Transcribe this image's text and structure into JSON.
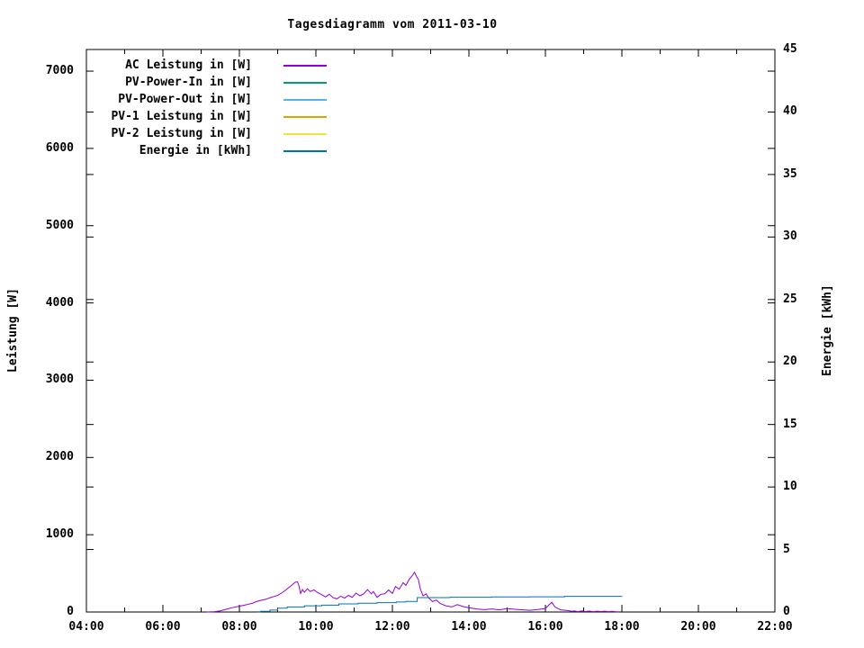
{
  "window": {
    "kind": "gnuplot-style daily PV diagram",
    "background": "#ffffff"
  },
  "chart_data": {
    "type": "line",
    "title": "Tagesdiagramm vom 2011-03-10",
    "grid": false,
    "legend_position": "top-left-inside-no-box",
    "x_axis": {
      "unit": "time-of-day",
      "range_hours": [
        4,
        22
      ],
      "major_tick_hours": [
        4,
        6,
        8,
        10,
        12,
        14,
        16,
        18,
        20,
        22
      ],
      "minor_tick_hours": [
        5,
        7,
        9,
        11,
        13,
        15,
        17,
        19,
        21
      ],
      "tick_labels": [
        "04:00",
        "06:00",
        "08:00",
        "10:00",
        "12:00",
        "14:00",
        "16:00",
        "18:00",
        "20:00",
        "22:00"
      ]
    },
    "y_axis_left": {
      "label": "Leistung [W]",
      "ticks": [
        0,
        1000,
        2000,
        3000,
        4000,
        5000,
        6000,
        7000
      ],
      "range": [
        0,
        7280
      ]
    },
    "y_axis_right": {
      "label": "Energie [kWh]",
      "ticks": [
        0,
        5,
        10,
        15,
        20,
        25,
        30,
        35,
        40,
        45
      ],
      "range": [
        0,
        45
      ]
    },
    "series": [
      {
        "name": "AC Leistung in [W]",
        "color": "#9400d3",
        "axis": "left",
        "style": "line",
        "points": [
          [
            7.15,
            0
          ],
          [
            7.35,
            5
          ],
          [
            7.5,
            15
          ],
          [
            7.65,
            35
          ],
          [
            7.8,
            55
          ],
          [
            7.95,
            70
          ],
          [
            8.05,
            80
          ],
          [
            8.2,
            95
          ],
          [
            8.35,
            115
          ],
          [
            8.45,
            135
          ],
          [
            8.55,
            150
          ],
          [
            8.7,
            165
          ],
          [
            8.8,
            185
          ],
          [
            8.9,
            200
          ],
          [
            9.0,
            215
          ],
          [
            9.1,
            245
          ],
          [
            9.2,
            280
          ],
          [
            9.3,
            320
          ],
          [
            9.4,
            360
          ],
          [
            9.46,
            385
          ],
          [
            9.52,
            390
          ],
          [
            9.55,
            350
          ],
          [
            9.6,
            240
          ],
          [
            9.65,
            290
          ],
          [
            9.7,
            255
          ],
          [
            9.78,
            300
          ],
          [
            9.85,
            265
          ],
          [
            9.95,
            285
          ],
          [
            10.05,
            250
          ],
          [
            10.15,
            225
          ],
          [
            10.25,
            195
          ],
          [
            10.35,
            230
          ],
          [
            10.45,
            185
          ],
          [
            10.55,
            170
          ],
          [
            10.65,
            205
          ],
          [
            10.75,
            180
          ],
          [
            10.85,
            215
          ],
          [
            10.95,
            190
          ],
          [
            11.05,
            245
          ],
          [
            11.15,
            210
          ],
          [
            11.25,
            235
          ],
          [
            11.35,
            290
          ],
          [
            11.45,
            235
          ],
          [
            11.5,
            265
          ],
          [
            11.6,
            190
          ],
          [
            11.7,
            230
          ],
          [
            11.8,
            235
          ],
          [
            11.9,
            285
          ],
          [
            12.0,
            240
          ],
          [
            12.08,
            330
          ],
          [
            12.18,
            295
          ],
          [
            12.28,
            380
          ],
          [
            12.35,
            345
          ],
          [
            12.45,
            430
          ],
          [
            12.52,
            470
          ],
          [
            12.58,
            515
          ],
          [
            12.63,
            460
          ],
          [
            12.68,
            420
          ],
          [
            12.73,
            300
          ],
          [
            12.8,
            210
          ],
          [
            12.88,
            235
          ],
          [
            12.95,
            180
          ],
          [
            13.05,
            135
          ],
          [
            13.15,
            155
          ],
          [
            13.25,
            110
          ],
          [
            13.4,
            80
          ],
          [
            13.55,
            65
          ],
          [
            13.7,
            95
          ],
          [
            13.85,
            70
          ],
          [
            14.0,
            55
          ],
          [
            14.2,
            40
          ],
          [
            14.4,
            30
          ],
          [
            14.6,
            40
          ],
          [
            14.8,
            28
          ],
          [
            15.0,
            45
          ],
          [
            15.2,
            35
          ],
          [
            15.4,
            28
          ],
          [
            15.6,
            22
          ],
          [
            15.8,
            32
          ],
          [
            16.0,
            45
          ],
          [
            16.1,
            95
          ],
          [
            16.17,
            125
          ],
          [
            16.25,
            65
          ],
          [
            16.4,
            28
          ],
          [
            16.6,
            18
          ],
          [
            16.7,
            8
          ],
          [
            16.75,
            14
          ],
          [
            16.85,
            5
          ],
          [
            16.95,
            14
          ],
          [
            17.05,
            6
          ],
          [
            17.15,
            12
          ],
          [
            17.25,
            5
          ],
          [
            17.35,
            11
          ],
          [
            17.45,
            6
          ],
          [
            17.55,
            10
          ],
          [
            17.65,
            5
          ],
          [
            17.75,
            8
          ],
          [
            17.85,
            3
          ],
          [
            17.92,
            2
          ]
        ]
      },
      {
        "name": "PV-Power-In in [W]",
        "color": "#009e73",
        "axis": "left",
        "style": "line",
        "points": []
      },
      {
        "name": "PV-Power-Out in [W]",
        "color": "#56b4e9",
        "axis": "left",
        "style": "line",
        "points": []
      },
      {
        "name": "PV-1 Leistung in [W]",
        "color": "#e69f00",
        "axis": "left",
        "style": "line",
        "points": []
      },
      {
        "name": "PV-2 Leistung in [W]",
        "color": "#f0e442",
        "axis": "left",
        "style": "line",
        "points": []
      },
      {
        "name": "Energie in [kWh]",
        "color": "#0072b2",
        "axis": "right",
        "style": "step",
        "points": [
          [
            8.45,
            0.02
          ],
          [
            8.55,
            0.05
          ],
          [
            8.8,
            0.15
          ],
          [
            9.0,
            0.3
          ],
          [
            9.25,
            0.4
          ],
          [
            9.7,
            0.5
          ],
          [
            10.15,
            0.55
          ],
          [
            10.6,
            0.65
          ],
          [
            11.1,
            0.7
          ],
          [
            11.6,
            0.75
          ],
          [
            12.1,
            0.8
          ],
          [
            12.35,
            0.85
          ],
          [
            12.65,
            1.15
          ],
          [
            13.5,
            1.18
          ],
          [
            14.6,
            1.2
          ],
          [
            15.6,
            1.22
          ],
          [
            16.5,
            1.25
          ],
          [
            18.0,
            1.27
          ]
        ]
      }
    ]
  },
  "legend": {
    "items": [
      {
        "label": "AC Leistung in [W]",
        "color": "#9400d3"
      },
      {
        "label": "PV-Power-In in [W]",
        "color": "#009e73"
      },
      {
        "label": "PV-Power-Out in [W]",
        "color": "#56b4e9"
      },
      {
        "label": "PV-1 Leistung in [W]",
        "color": "#e69f00"
      },
      {
        "label": "PV-2 Leistung in [W]",
        "color": "#f0e442"
      },
      {
        "label": "Energie in [kWh]",
        "color": "#0072b2"
      }
    ]
  }
}
